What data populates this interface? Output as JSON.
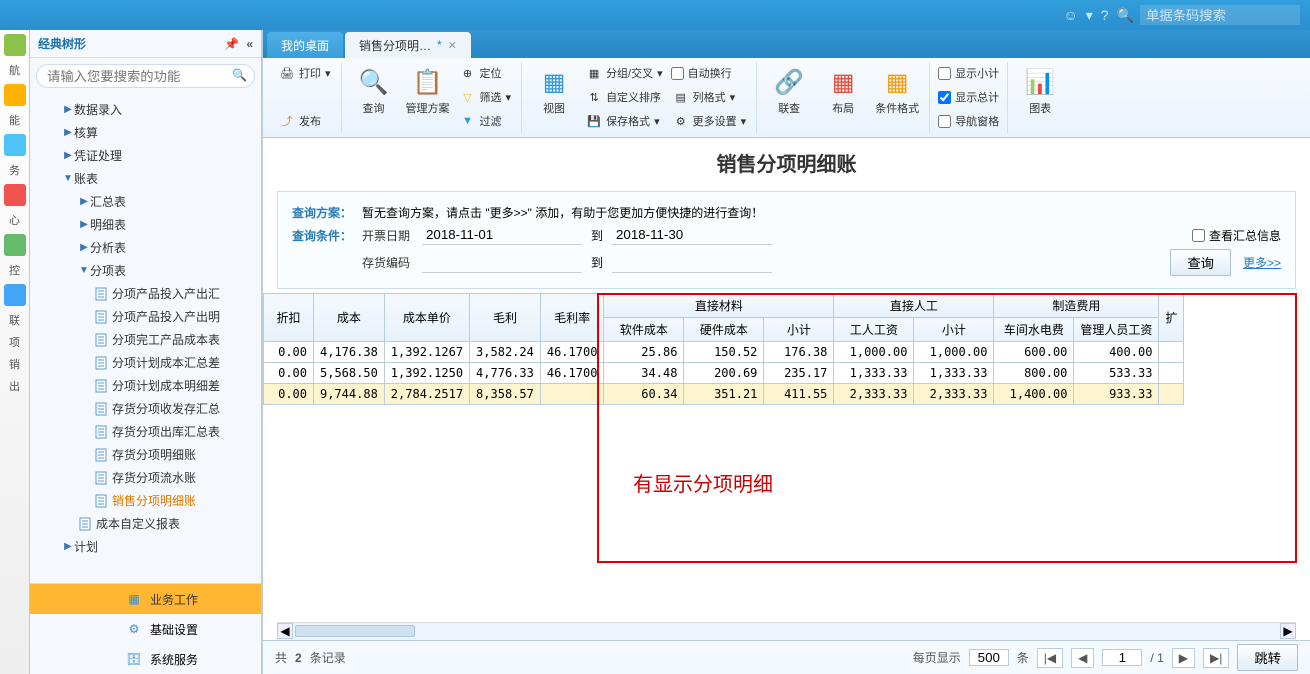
{
  "topbar": {
    "search_placeholder": "单据条码搜索"
  },
  "sidebar": {
    "title": "经典树形",
    "search_placeholder": "请输入您要搜索的功能",
    "items": [
      {
        "level": 2,
        "caret": "▶",
        "label": "数据录入"
      },
      {
        "level": 2,
        "caret": "▶",
        "label": "核算"
      },
      {
        "level": 2,
        "caret": "▶",
        "label": "凭证处理"
      },
      {
        "level": 2,
        "caret": "▼",
        "label": "账表"
      },
      {
        "level": 3,
        "caret": "▶",
        "label": "汇总表"
      },
      {
        "level": 3,
        "caret": "▶",
        "label": "明细表"
      },
      {
        "level": 3,
        "caret": "▶",
        "label": "分析表"
      },
      {
        "level": 3,
        "caret": "▼",
        "label": "分项表"
      },
      {
        "level": 4,
        "doc": true,
        "label": "分项产品投入产出汇"
      },
      {
        "level": 4,
        "doc": true,
        "label": "分项产品投入产出明"
      },
      {
        "level": 4,
        "doc": true,
        "label": "分项完工产品成本表"
      },
      {
        "level": 4,
        "doc": true,
        "label": "分项计划成本汇总差"
      },
      {
        "level": 4,
        "doc": true,
        "label": "分项计划成本明细差"
      },
      {
        "level": 4,
        "doc": true,
        "label": "存货分项收发存汇总"
      },
      {
        "level": 4,
        "doc": true,
        "label": "存货分项出库汇总表"
      },
      {
        "level": 4,
        "doc": true,
        "label": "存货分项明细账"
      },
      {
        "level": 4,
        "doc": true,
        "label": "存货分项流水账"
      },
      {
        "level": 4,
        "doc": true,
        "label": "销售分项明细账",
        "active": true
      },
      {
        "level": 3,
        "doc": true,
        "label": "成本自定义报表"
      },
      {
        "level": 2,
        "caret": "▶",
        "label": "计划"
      }
    ],
    "bottom": [
      {
        "label": "业务工作",
        "active": true
      },
      {
        "label": "基础设置"
      },
      {
        "label": "系统服务"
      }
    ]
  },
  "leftstrip": [
    {
      "label": "航",
      "color": "#8bc34a"
    },
    {
      "label": "能",
      "color": "#ffb300"
    },
    {
      "label": "务",
      "color": "#4fc3f7"
    },
    {
      "label": "心",
      "color": "#ef5350"
    },
    {
      "label": "控",
      "color": "#66bb6a"
    },
    {
      "label": "联",
      "color": "#42a5f5"
    },
    {
      "label": "项",
      "color": ""
    },
    {
      "label": "销",
      "color": ""
    },
    {
      "label": "出",
      "color": ""
    }
  ],
  "tabs": [
    {
      "label": "我的桌面",
      "active": false
    },
    {
      "label": "销售分项明…",
      "active": true,
      "dirty": "*"
    }
  ],
  "ribbon": {
    "print": "打印",
    "publish": "发布",
    "query": "查询",
    "mgmtplan": "管理方案",
    "locate": "定位",
    "filter": "筛选",
    "filter2": "过滤",
    "view": "视图",
    "grouping": "分组/交叉",
    "customsort": "自定义排序",
    "savefmt": "保存格式",
    "autowrap": "自动换行",
    "colfmt": "列格式",
    "moreset": "更多设置",
    "drill": "联查",
    "layout": "布局",
    "condfmt": "条件格式",
    "showsubtotal": "显示小计",
    "showtotal": "显示总计",
    "navpane": "导航窗格",
    "chart": "图表"
  },
  "page": {
    "title": "销售分项明细账"
  },
  "query": {
    "plan_label": "查询方案：",
    "plan_hint": "暂无查询方案，请点击 \"更多>>\" 添加，有助于您更加方便快捷的进行查询！",
    "cond_label": "查询条件：",
    "invoicedate": "开票日期",
    "date_from": "2018-11-01",
    "to": "到",
    "date_to": "2018-11-30",
    "stockcode": "存货编码",
    "viewsummary": "查看汇总信息",
    "query_btn": "查询",
    "more_link": "更多>>"
  },
  "table": {
    "group_headers": {
      "direct_mat": "直接材料",
      "direct_labor": "直接人工",
      "mfg_expense": "制造费用"
    },
    "cols": {
      "discount": "折扣",
      "cost": "成本",
      "unitcost": "成本单价",
      "gross": "毛利",
      "grossrate": "毛利率",
      "softcost": "软件成本",
      "hardcost": "硬件成本",
      "subtotal1": "小计",
      "wage": "工人工资",
      "subtotal2": "小计",
      "utility": "车间水电费",
      "mgrwage": "管理人员工资",
      "ext": "扩"
    },
    "rows": [
      {
        "discount": "0.00",
        "cost": "4,176.38",
        "unitcost": "1,392.1267",
        "gross": "3,582.24",
        "grossrate": "46.1700",
        "softcost": "25.86",
        "hardcost": "150.52",
        "subtotal1": "176.38",
        "wage": "1,000.00",
        "subtotal2": "1,000.00",
        "utility": "600.00",
        "mgrwage": "400.00"
      },
      {
        "discount": "0.00",
        "cost": "5,568.50",
        "unitcost": "1,392.1250",
        "gross": "4,776.33",
        "grossrate": "46.1700",
        "softcost": "34.48",
        "hardcost": "200.69",
        "subtotal1": "235.17",
        "wage": "1,333.33",
        "subtotal2": "1,333.33",
        "utility": "800.00",
        "mgrwage": "533.33"
      },
      {
        "discount": "0.00",
        "cost": "9,744.88",
        "unitcost": "2,784.2517",
        "gross": "8,358.57",
        "grossrate": "",
        "softcost": "60.34",
        "hardcost": "351.21",
        "subtotal1": "411.55",
        "wage": "2,333.33",
        "subtotal2": "2,333.33",
        "utility": "1,400.00",
        "mgrwage": "933.33",
        "total": true
      }
    ]
  },
  "callout": "有显示分项明细",
  "footer": {
    "records_prefix": "共 ",
    "records_count": "2",
    "records_suffix": " 条记录",
    "pagesize_label": "每页显示",
    "pagesize": "500",
    "unit": "条",
    "page": "1",
    "pages": "1",
    "jump": "跳转"
  }
}
